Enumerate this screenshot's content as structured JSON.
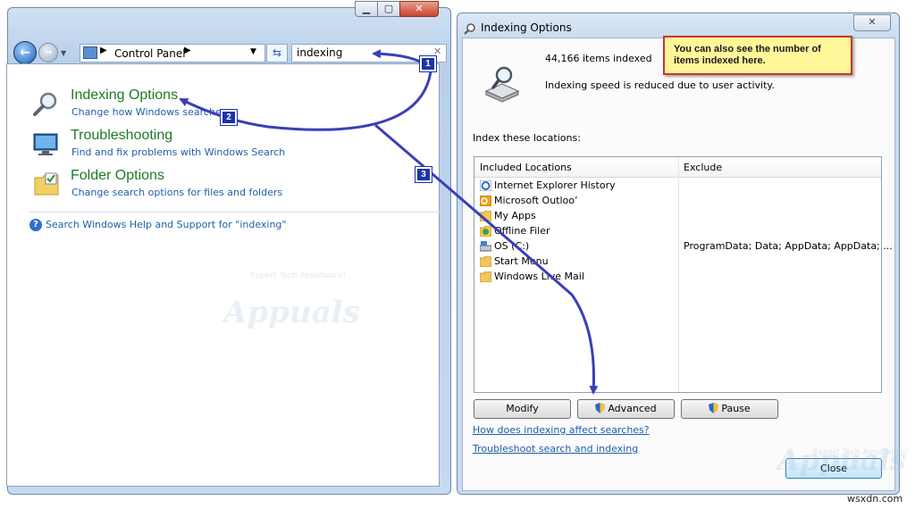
{
  "control_panel": {
    "address_location": "Control Panel",
    "search_value": "indexing",
    "results": [
      {
        "title": "Indexing Options",
        "subtitle": "Change how Windows searches"
      },
      {
        "title": "Troubleshooting",
        "subtitle": "Find and fix problems with Windows Search"
      },
      {
        "title": "Folder Options",
        "subtitle": "Change search options for files and folders"
      }
    ],
    "help_link": "Search Windows Help and Support for \"indexing\""
  },
  "indexing_options": {
    "title": "Indexing Options",
    "items_indexed": "44,166 items indexed",
    "speed_status": "Indexing speed is reduced due to user activity.",
    "index_label": "Index these locations:",
    "columns": {
      "included": "Included Locations",
      "exclude": "Exclude"
    },
    "locations": [
      {
        "name": "Internet Explorer History",
        "exclude": "",
        "icon": "ie-icon"
      },
      {
        "name": "Microsoft Outloo’",
        "exclude": "",
        "icon": "outlook-icon"
      },
      {
        "name": "My Apps",
        "exclude": "",
        "icon": "folder-icon"
      },
      {
        "name": "Offline Filer",
        "exclude": "",
        "icon": "offline-files-icon"
      },
      {
        "name": "OS (C:)",
        "exclude": "ProgramData; Data; AppData; AppData; ...",
        "icon": "drive-icon"
      },
      {
        "name": "Start Menu",
        "exclude": "",
        "icon": "folder-icon"
      },
      {
        "name": "Windows Live Mail",
        "exclude": "",
        "icon": "folder-icon"
      }
    ],
    "buttons": {
      "modify": "Modify",
      "advanced": "Advanced",
      "pause": "Pause",
      "close": "Close"
    },
    "links": {
      "how": "How does indexing affect searches?",
      "troubleshoot": "Troubleshoot search and indexing"
    }
  },
  "annotations": {
    "callout": "You can also see the number of items indexed here.",
    "steps": [
      "1",
      "2",
      "3"
    ],
    "arrow_color": "#3a3fb8",
    "callout_border": "#c8362a",
    "callout_fill": "#fff79a"
  },
  "watermark": {
    "brand": "Appuals",
    "tagline": "Expert Tech Assistance!"
  },
  "footer": {
    "site": "wsxdn.com"
  }
}
